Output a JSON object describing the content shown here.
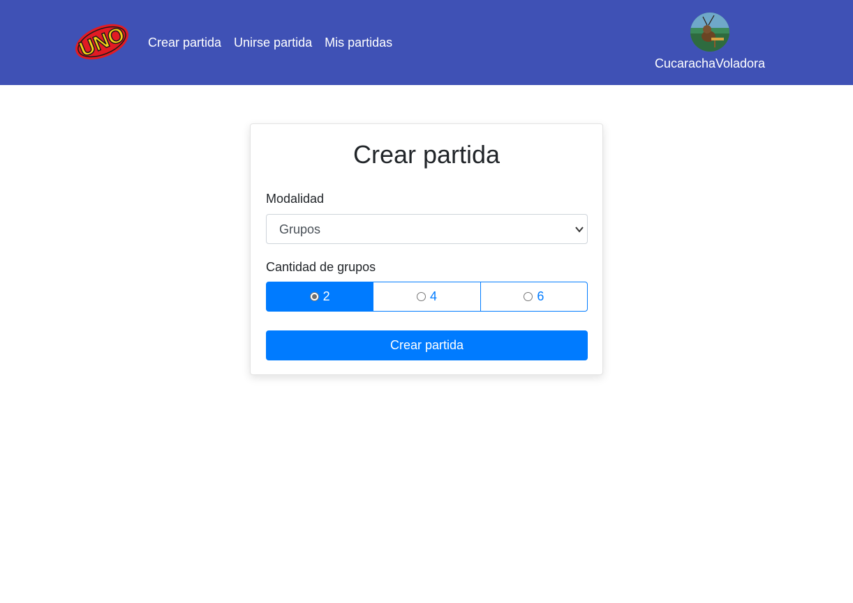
{
  "navbar": {
    "logo_text": "UNO",
    "links": [
      "Crear partida",
      "Unirse partida",
      "Mis partidas"
    ],
    "user": {
      "name": "CucarachaVoladora",
      "avatar_icon": "avatar-icon"
    },
    "background": "#3f51b5"
  },
  "form": {
    "title": "Crear partida",
    "modality_label": "Modalidad",
    "modality_value": "Grupos",
    "groups_label": "Cantidad de grupos",
    "group_options": [
      "2",
      "4",
      "6"
    ],
    "selected_group": "2",
    "submit_label": "Crear partida",
    "accent": "#007bff"
  }
}
